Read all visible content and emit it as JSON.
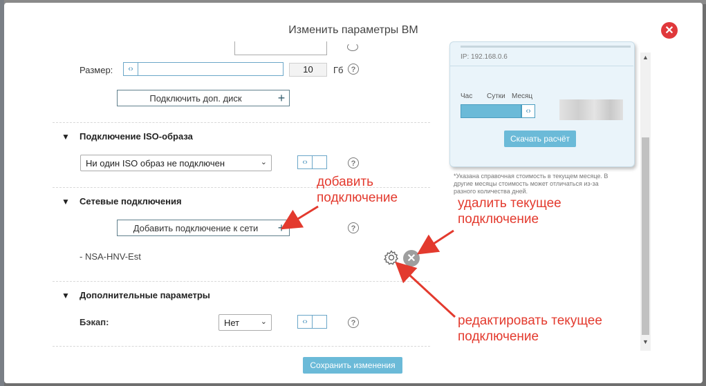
{
  "modal": {
    "title": "Изменить параметры ВМ",
    "close_icon": "close-icon"
  },
  "disk": {
    "size_label": "Размер:",
    "size_value": "10",
    "size_unit": "Гб",
    "add_disk_button": "Подключить доп. диск"
  },
  "iso": {
    "section_title": "Подключение ISO-образа",
    "select_value": "Ни один ISO образ не подключен"
  },
  "network": {
    "section_title": "Сетевые подключения",
    "add_button": "Добавить подключение к сети",
    "connections": [
      "- NSA-HNV-Est"
    ]
  },
  "extra": {
    "section_title": "Дополнительные параметры",
    "backup_label": "Бэкап:",
    "backup_value": "Нет"
  },
  "save_button": "Сохранить изменения",
  "summary": {
    "ip_line": "IP: 192.168.0.6",
    "periods": [
      "Час",
      "Сутки",
      "Месяц"
    ],
    "download_button": "Скачать расчёт",
    "footnote": "*Указана справочная стоимость в текущем месяце. В другие месяцы стоимость может отличаться из-за разного количества дней."
  },
  "annotations": {
    "add": [
      "добавить",
      "подключение"
    ],
    "delete": [
      "удалить текущее",
      "подключение"
    ],
    "edit": [
      "редактировать текущее",
      "подключение"
    ]
  },
  "colors": {
    "accent": "#6bbad8",
    "annotation": "#e33a2e",
    "close": "#e0383b"
  }
}
